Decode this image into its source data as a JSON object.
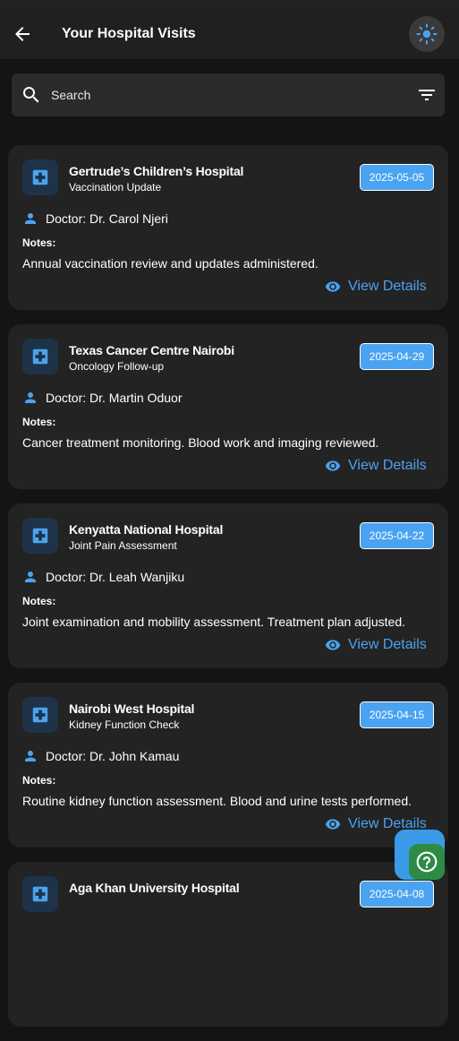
{
  "app_bar": {
    "title": "Your Hospital Visits",
    "back_icon": "arrow-back-icon",
    "theme_icon": "sun-icon"
  },
  "search": {
    "placeholder": "Search",
    "search_icon": "search-icon",
    "filter_icon": "filter-icon"
  },
  "colors": {
    "accent": "#4aa3f0",
    "card_bg": "#232323",
    "page_bg": "#141414",
    "help_fab": "#2e8b45"
  },
  "visits": [
    {
      "hospital": "Gertrude’s Children’s Hospital",
      "purpose": "Vaccination Update",
      "date": "2025-05-05",
      "doctor": "Doctor: Dr. Carol Njeri",
      "notes_label": "Notes:",
      "notes": "Annual vaccination review and updates administered.",
      "action": "View Details"
    },
    {
      "hospital": "Texas Cancer Centre Nairobi",
      "purpose": "Oncology Follow-up",
      "date": "2025-04-29",
      "doctor": "Doctor: Dr. Martin Oduor",
      "notes_label": "Notes:",
      "notes": "Cancer treatment monitoring. Blood work and imaging reviewed.",
      "action": "View Details"
    },
    {
      "hospital": "Kenyatta National Hospital",
      "purpose": "Joint Pain Assessment",
      "date": "2025-04-22",
      "doctor": "Doctor: Dr. Leah Wanjiku",
      "notes_label": "Notes:",
      "notes": "Joint examination and mobility assessment. Treatment plan adjusted.",
      "action": "View Details"
    },
    {
      "hospital": "Nairobi West Hospital",
      "purpose": "Kidney Function Check",
      "date": "2025-04-15",
      "doctor": "Doctor: Dr. John Kamau",
      "notes_label": "Notes:",
      "notes": "Routine kidney function assessment. Blood and urine tests performed.",
      "action": "View Details"
    },
    {
      "hospital": "Aga Khan University Hospital",
      "purpose": "",
      "date": "2025-04-08",
      "doctor": "",
      "notes_label": "",
      "notes": "",
      "action": ""
    }
  ],
  "fab": {
    "help_icon": "help-circle-icon"
  }
}
